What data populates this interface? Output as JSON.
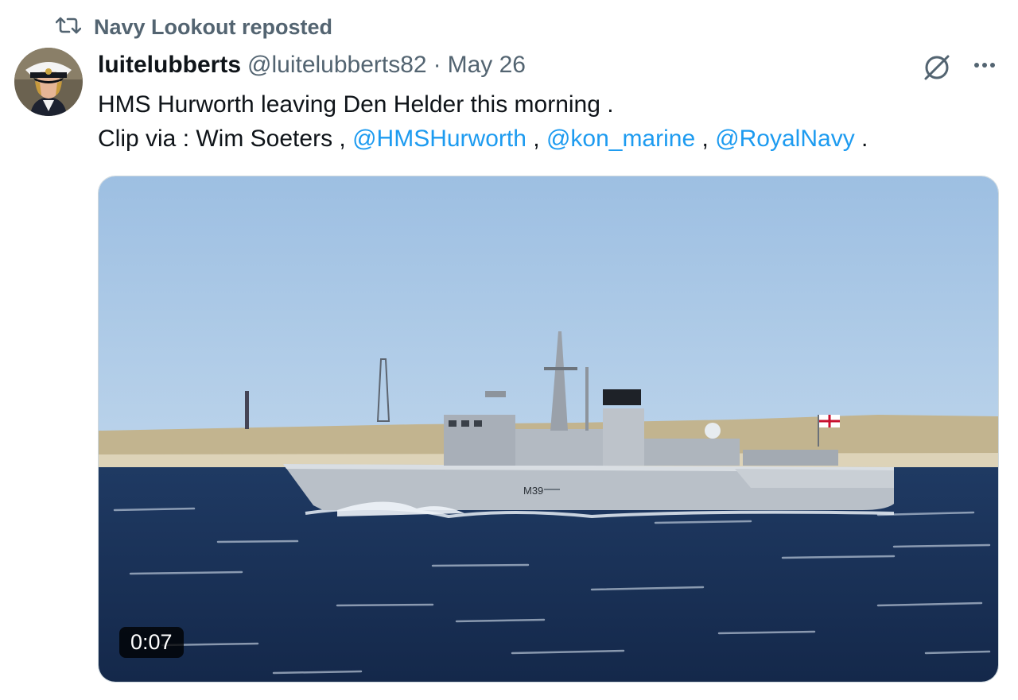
{
  "repost": {
    "label": "Navy Lookout reposted"
  },
  "author": {
    "display_name": "luitelubberts",
    "handle": "@luitelubberts82",
    "separator": "·",
    "date": "May 26"
  },
  "tweet": {
    "line1": "HMS Hurworth leaving Den Helder this morning .",
    "line2_prefix": "Clip via : Wim Soeters ,",
    "mention1": "@HMSHurworth",
    "sep1": ",",
    "mention2": "@kon_marine",
    "sep2": ",",
    "mention3": "@RoyalNavy",
    "end": "."
  },
  "media": {
    "duration": "0:07",
    "hull_number": "M39"
  },
  "icons": {
    "repost": "repost-icon",
    "grok": "grok-icon",
    "more": "more-dots-icon"
  },
  "colors": {
    "link": "#1d9bf0",
    "secondary_text": "#536471",
    "primary_text": "#0f1419"
  }
}
